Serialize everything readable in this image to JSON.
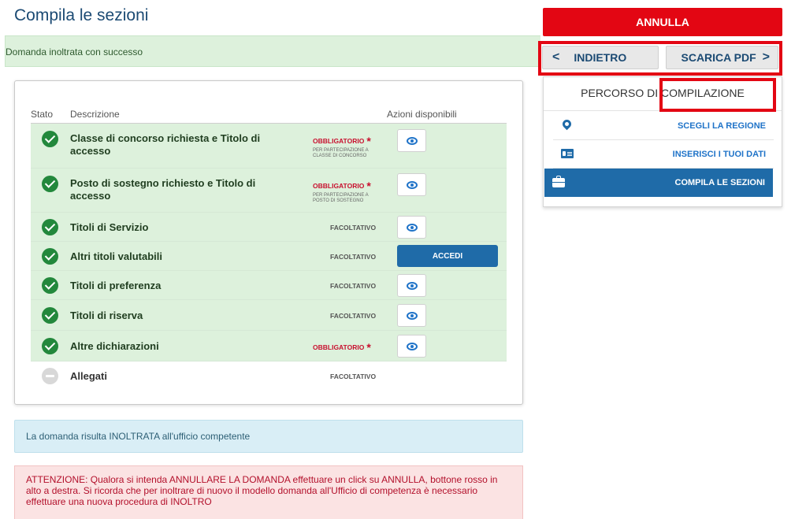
{
  "page": {
    "title": "Compila le sezioni"
  },
  "alerts": {
    "success": "Domanda inoltrata con successo",
    "info": "La domanda risulta INOLTRATA all'ufficio competente",
    "danger": "ATTENZIONE: Qualora si intenda ANNULLARE LA DOMANDA effettuare un click su ANNULLA, bottone rosso in alto a destra. Si ricorda che per inoltrare di nuovo il modello domanda all'Ufficio di competenza è necessario effettuare una nuova procedura di INOLTRO"
  },
  "table": {
    "headers": {
      "stato": "Stato",
      "descrizione": "Descrizione",
      "azioni": "Azioni disponibili"
    },
    "rows": [
      {
        "desc": "Classe di concorso richiesta e Titolo di accesso",
        "req": "OBBLIGATORIO",
        "note": "PER PARTECIPAZIONE A CLASSE DI CONCORSO"
      },
      {
        "desc": "Posto di sostegno richiesto e Titolo di accesso",
        "req": "OBBLIGATORIO",
        "note": "PER PARTECIPAZIONE A POSTO DI SOSTEGNO"
      },
      {
        "desc": "Titoli di Servizio",
        "req": "FACOLTATIVO"
      },
      {
        "desc": "Altri titoli valutabili",
        "req": "FACOLTATIVO",
        "action": "ACCEDI"
      },
      {
        "desc": "Titoli di preferenza",
        "req": "FACOLTATIVO"
      },
      {
        "desc": "Titoli di riserva",
        "req": "FACOLTATIVO"
      },
      {
        "desc": "Altre dichiarazioni",
        "req": "OBBLIGATORIO"
      },
      {
        "desc": "Allegati",
        "req": "FACOLTATIVO"
      }
    ],
    "required_star": "*"
  },
  "actions": {
    "annulla": "ANNULLA",
    "indietro": "INDIETRO",
    "scarica": "SCARICA PDF",
    "chev_left": "<",
    "chev_right": ">"
  },
  "sidebar": {
    "title": "PERCORSO DI COMPILAZIONE",
    "items": [
      {
        "label": "SCEGLI LA REGIONE",
        "icon": "map-pin-icon"
      },
      {
        "label": "INSERISCI I TUOI DATI",
        "icon": "id-card-icon"
      },
      {
        "label": "COMPILA LE SEZIONI",
        "icon": "briefcase-icon",
        "active": true
      }
    ]
  },
  "colors": {
    "primary": "#1f6ba8",
    "danger": "#e30613",
    "success": "#23883c"
  }
}
